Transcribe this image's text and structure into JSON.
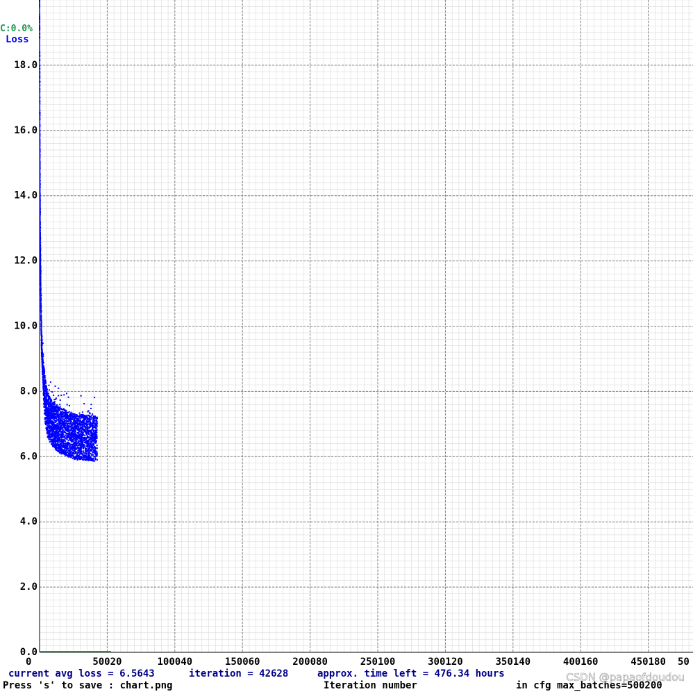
{
  "chart_data": {
    "type": "scatter",
    "title": "",
    "xlabel": "Iteration number",
    "ylabel": "",
    "xlim": [
      0,
      500200
    ],
    "ylim": [
      0,
      20
    ],
    "x_ticks": [
      "0",
      "50020",
      "100040",
      "150060",
      "200080",
      "250100",
      "300120",
      "350140",
      "400160",
      "450180",
      "50"
    ],
    "y_ticks": [
      "0.0",
      "2.0",
      "4.0",
      "6.0",
      "8.0",
      "10.0",
      "12.0",
      "14.0",
      "16.0",
      "18.0"
    ],
    "grid": true,
    "legend": [
      "C:0.0%",
      "Loss"
    ],
    "series": [
      {
        "name": "Loss",
        "color": "#0000ff",
        "x": [
          0,
          50,
          100,
          150,
          200,
          300,
          400,
          500,
          700,
          1000,
          1500,
          2000,
          2500,
          3000,
          4000,
          5000,
          6000,
          8000,
          10000,
          12000,
          15000,
          18000,
          21000,
          24000,
          27000,
          30000,
          33000,
          36000,
          39000,
          42628
        ],
        "y": [
          20.5,
          19.0,
          18.0,
          17.0,
          16.0,
          14.5,
          13.5,
          12.5,
          11.8,
          10.5,
          9.5,
          9.0,
          8.6,
          8.2,
          7.8,
          7.5,
          7.3,
          7.1,
          7.0,
          6.9,
          6.8,
          6.75,
          6.7,
          6.65,
          6.6,
          6.6,
          6.58,
          6.57,
          6.56,
          6.5643
        ],
        "spread": 0.7
      },
      {
        "name": "C:0.0%",
        "color": "#1a9a4a",
        "x": [
          0,
          42628
        ],
        "y": [
          0,
          0
        ]
      }
    ],
    "status": {
      "avg_loss": "current avg loss = 6.5643",
      "iteration": "iteration = 42628",
      "time_left": "approx. time left = 476.34 hours"
    },
    "footer": {
      "save_hint": "Press 's' to save : chart.png",
      "axis_caption": "Iteration number",
      "max_batches": "in cfg max_batches=500200"
    },
    "watermark": "CSDN @papaofdoudou",
    "colors": {
      "background": "#ffffff",
      "major_grid": "#7f7f7f",
      "minor_grid": "#d9d9d9",
      "loss": "#0000ff",
      "map": "#1a9a4a",
      "status_text": "#00008b"
    }
  }
}
